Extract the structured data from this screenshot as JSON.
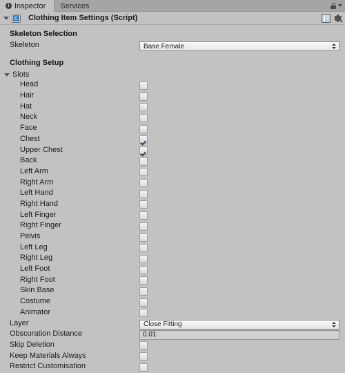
{
  "window": {
    "tabs": [
      {
        "label": "Inspector",
        "icon": "info-icon",
        "active": true
      },
      {
        "label": "Services",
        "icon": null,
        "active": false
      }
    ],
    "lock_icon": "lock-icon",
    "menu_icon": "chevron-down-icon"
  },
  "component": {
    "title": "Clothing Item Settings (Script)",
    "foldout_icon": "triangle-down-icon",
    "script_icon": "script-icon",
    "help_icon": "help-icon",
    "gear_icon": "gear-icon",
    "expanded": true
  },
  "sections": {
    "skeleton_selection": {
      "heading": "Skeleton Selection",
      "skeleton": {
        "label": "Skeleton",
        "value": "Base Female",
        "control": "popup"
      }
    },
    "clothing_setup": {
      "heading": "Clothing Setup",
      "slots": {
        "label": "Slots",
        "expanded": true,
        "items": [
          {
            "label": "Head",
            "checked": false
          },
          {
            "label": "Hair",
            "checked": false
          },
          {
            "label": "Hat",
            "checked": false
          },
          {
            "label": "Neck",
            "checked": false
          },
          {
            "label": "Face",
            "checked": false
          },
          {
            "label": "Chest",
            "checked": true
          },
          {
            "label": "Upper Chest",
            "checked": true
          },
          {
            "label": "Back",
            "checked": false
          },
          {
            "label": "Left Arm",
            "checked": false
          },
          {
            "label": "Right Arm",
            "checked": false
          },
          {
            "label": "Left Hand",
            "checked": false
          },
          {
            "label": "Right Hand",
            "checked": false
          },
          {
            "label": "Left Finger",
            "checked": false
          },
          {
            "label": "Right Finger",
            "checked": false
          },
          {
            "label": "Pelvis",
            "checked": false
          },
          {
            "label": "Left Leg",
            "checked": false
          },
          {
            "label": "Right Leg",
            "checked": false
          },
          {
            "label": "Left Foot",
            "checked": false
          },
          {
            "label": "Right Foot",
            "checked": false
          },
          {
            "label": "Skin Base",
            "checked": false
          },
          {
            "label": "Costume",
            "checked": false
          },
          {
            "label": "Animator",
            "checked": false
          }
        ]
      },
      "properties": [
        {
          "label": "Layer",
          "control": "popup",
          "value": "Close Fitting"
        },
        {
          "label": "Obscuration Distance",
          "control": "textfield",
          "value": "0.01"
        },
        {
          "label": "Skip Deletion",
          "control": "checkbox",
          "checked": false
        },
        {
          "label": "Keep Materials Always",
          "control": "checkbox",
          "checked": false
        },
        {
          "label": "Restrict Customisation",
          "control": "checkbox",
          "checked": false
        }
      ]
    }
  },
  "colors": {
    "background": "#c2c2c2",
    "tabbar": "#a5a5a5",
    "check_mark": "#2b3f66",
    "script_icon_blue": "#2e7fc2"
  }
}
